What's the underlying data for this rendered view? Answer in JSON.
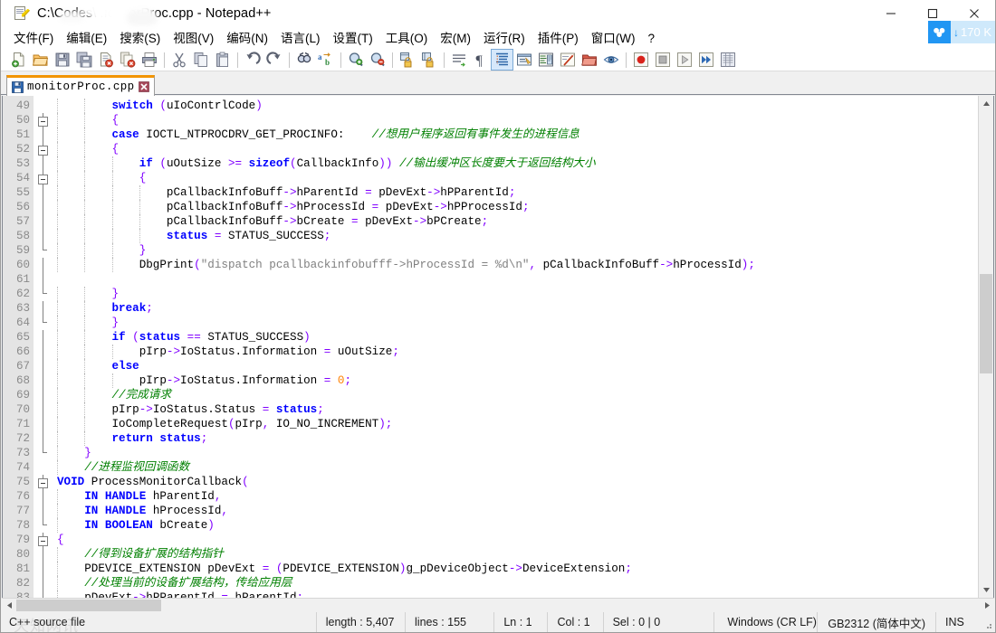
{
  "window": {
    "title": "C:\\Codes\\          .ıonitorProc.cpp - Notepad++",
    "title_visible_prefix": "C:\\Codes\\",
    "title_visible_suffix": ".onitorProc.cpp - Notepad++",
    "app_name": "Notepad++",
    "icon": "notepad-plus-plus-icon",
    "minimize_label": "—",
    "maximize_label": "□",
    "close_label": "✕"
  },
  "download_badge": {
    "icon": "baidu-cloud-icon",
    "arrow": "↓",
    "amount": "170 K"
  },
  "menu": {
    "items": [
      {
        "label": "文件(F)",
        "name": "menu-file"
      },
      {
        "label": "编辑(E)",
        "name": "menu-edit"
      },
      {
        "label": "搜索(S)",
        "name": "menu-search"
      },
      {
        "label": "视图(V)",
        "name": "menu-view"
      },
      {
        "label": "编码(N)",
        "name": "menu-encoding"
      },
      {
        "label": "语言(L)",
        "name": "menu-language"
      },
      {
        "label": "设置(T)",
        "name": "menu-settings"
      },
      {
        "label": "工具(O)",
        "name": "menu-tools"
      },
      {
        "label": "宏(M)",
        "name": "menu-macro"
      },
      {
        "label": "运行(R)",
        "name": "menu-run"
      },
      {
        "label": "插件(P)",
        "name": "menu-plugins"
      },
      {
        "label": "窗口(W)",
        "name": "menu-window"
      },
      {
        "label": "?",
        "name": "menu-help"
      }
    ]
  },
  "toolbar": {
    "buttons": [
      "new-file-icon",
      "open-file-icon",
      "save-icon",
      "save-all-icon",
      "close-file-icon",
      "close-all-icon",
      "print-icon",
      "sep",
      "cut-icon",
      "copy-icon",
      "paste-icon",
      "sep",
      "undo-icon",
      "redo-icon",
      "sep",
      "find-icon",
      "replace-icon",
      "sep",
      "zoom-in-icon",
      "zoom-out-icon",
      "sep",
      "sync-vertical-scroll-icon",
      "sync-horizontal-scroll-icon",
      "sep",
      "word-wrap-icon",
      "show-all-characters-icon",
      "indent-guideline-icon",
      "user-defined-dialog-icon",
      "show-document-map-icon",
      "function-list-icon",
      "folder-as-workspace-icon",
      "monitoring-icon",
      "sep",
      "macro-record-icon",
      "macro-stop-icon",
      "macro-play-icon",
      "macro-playback-multiple-icon",
      "macro-save-icon"
    ]
  },
  "tab": {
    "icon": "save-file-icon",
    "label": "monitorProc.cpp",
    "close_icon": "close-tab-icon"
  },
  "editor": {
    "first_line": 49,
    "lines": [
      {
        "n": 49,
        "fold": "none",
        "text": "        switch (uIoContrlCode)"
      },
      {
        "n": 50,
        "fold": "box",
        "text": "        {"
      },
      {
        "n": 51,
        "fold": "line",
        "text": "        case IOCTL_NTPROCDRV_GET_PROCINFO:    //想用户程序返回有事件发生的进程信息"
      },
      {
        "n": 52,
        "fold": "box",
        "text": "        {"
      },
      {
        "n": 53,
        "fold": "line",
        "text": "            if (uOutSize >= sizeof(CallbackInfo)) //输出缓冲区长度要大于返回结构大小"
      },
      {
        "n": 54,
        "fold": "box",
        "text": "            {"
      },
      {
        "n": 55,
        "fold": "line",
        "text": "                pCallbackInfoBuff->hParentId = pDevExt->hPParentId;"
      },
      {
        "n": 56,
        "fold": "line",
        "text": "                pCallbackInfoBuff->hProcessId = pDevExt->hPProcessId;"
      },
      {
        "n": 57,
        "fold": "line",
        "text": "                pCallbackInfoBuff->bCreate = pDevExt->bPCreate;"
      },
      {
        "n": 58,
        "fold": "line",
        "text": "                status = STATUS_SUCCESS;"
      },
      {
        "n": 59,
        "fold": "tail",
        "text": "            }"
      },
      {
        "n": 60,
        "fold": "line",
        "text": "            DbgPrint(\"dispatch pcallbackinfobufff->hProcessId = %d\\n\", pCallbackInfoBuff->hProcessId);"
      },
      {
        "n": 61,
        "fold": "line",
        "text": ""
      },
      {
        "n": 62,
        "fold": "tail",
        "text": "        }"
      },
      {
        "n": 63,
        "fold": "line",
        "text": "        break;"
      },
      {
        "n": 64,
        "fold": "tail",
        "text": "        }"
      },
      {
        "n": 65,
        "fold": "line",
        "text": "        if (status == STATUS_SUCCESS)"
      },
      {
        "n": 66,
        "fold": "line",
        "text": "            pIrp->IoStatus.Information = uOutSize;"
      },
      {
        "n": 67,
        "fold": "line",
        "text": "        else"
      },
      {
        "n": 68,
        "fold": "line",
        "text": "            pIrp->IoStatus.Information = 0;"
      },
      {
        "n": 69,
        "fold": "line",
        "text": "        //完成请求"
      },
      {
        "n": 70,
        "fold": "line",
        "text": "        pIrp->IoStatus.Status = status;"
      },
      {
        "n": 71,
        "fold": "line",
        "text": "        IoCompleteRequest(pIrp, IO_NO_INCREMENT);"
      },
      {
        "n": 72,
        "fold": "line",
        "text": "        return status;"
      },
      {
        "n": 73,
        "fold": "end",
        "text": "    }"
      },
      {
        "n": 74,
        "fold": "none",
        "text": "    //进程监视回调函数"
      },
      {
        "n": 75,
        "fold": "box-root",
        "text": "VOID ProcessMonitorCallback("
      },
      {
        "n": 76,
        "fold": "line2",
        "text": "    IN HANDLE hParentId,"
      },
      {
        "n": 77,
        "fold": "line2",
        "text": "    IN HANDLE hProcessId,"
      },
      {
        "n": 78,
        "fold": "tail2",
        "text": "    IN BOOLEAN bCreate)"
      },
      {
        "n": 79,
        "fold": "box-root",
        "text": "{"
      },
      {
        "n": 80,
        "fold": "line2",
        "text": "    //得到设备扩展的结构指针"
      },
      {
        "n": 81,
        "fold": "line2",
        "text": "    PDEVICE_EXTENSION pDevExt = (PDEVICE_EXTENSION)g_pDeviceObject->DeviceExtension;"
      },
      {
        "n": 82,
        "fold": "line2",
        "text": "    //处理当前的设备扩展结构，传给应用层"
      },
      {
        "n": 83,
        "fold": "line2",
        "text": "    pDevExt->hPParentId = hParentId;"
      }
    ],
    "scrollbar": {
      "up_arrow": "▲",
      "down_arrow": "▼",
      "left_arrow": "◀",
      "right_arrow": "▶"
    }
  },
  "status": {
    "doc_type": "C++ source file",
    "length_label": "length : 5,407",
    "lines_label": "lines : 155",
    "ln": "Ln : 1",
    "col": "Col : 1",
    "sel": "Sel : 0 | 0",
    "eol": "Windows (CR LF)",
    "encoding": "GB2312 (简体中文)",
    "mode": "INS",
    "watermark": "天知网讯"
  },
  "colors": {
    "keyword": "#0000ff",
    "comment": "#008000",
    "string": "#808080",
    "number": "#ff8000",
    "operator": "#8000ff",
    "tab_accent": "#f29400",
    "badge_blue": "#2196f3",
    "gutter_bg": "#e4e4e4"
  }
}
